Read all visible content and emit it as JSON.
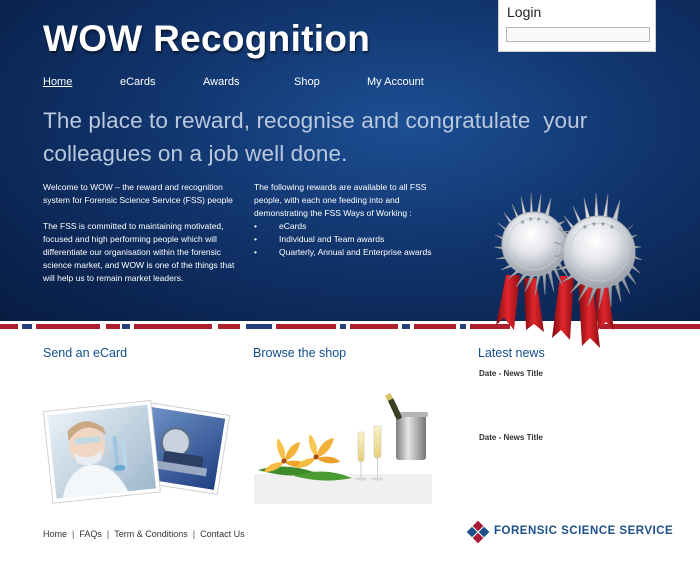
{
  "brand": {
    "title": "WOW Recognition"
  },
  "login": {
    "title": "Login",
    "input_value": ""
  },
  "nav": {
    "items": [
      {
        "label": "Home",
        "active": true
      },
      {
        "label": "eCards"
      },
      {
        "label": "Awards"
      },
      {
        "label": "Shop"
      },
      {
        "label": "My Account"
      }
    ]
  },
  "hero": {
    "tagline_line1": "The place to reward, recognise and congratulate  your",
    "tagline_line2": "colleagues on a job well done.",
    "intro": "Welcome to WOW – the reward and recognition system for Forensic Science Service (FSS) people",
    "commitment": "The FSS is committed to maintaining motivated, focused and high performing people which will differentiate our organisation within the forensic science market, and WOW is one of the things that will help us to remain market leaders.",
    "rewards_intro": "The following rewards are available to all FSS people, with each one feeding into and demonstrating the FSS Ways of Working :",
    "rewards": [
      "eCards",
      "Individual and Team awards",
      "Quarterly, Annual and Enterprise awards"
    ]
  },
  "sections": {
    "ecard_title": "Send an eCard",
    "shop_title": "Browse the shop",
    "news_title": "Latest news",
    "news_items": [
      "Date - News Title",
      "Date - News Title"
    ]
  },
  "footer": {
    "links": [
      "Home",
      "FAQs",
      "Term & Conditions",
      "Contact Us"
    ],
    "sep": "|",
    "logo_text": "FORENSIC SCIENCE SERVICE"
  },
  "colors": {
    "hero_bg": "#11346c",
    "section_title": "#124f8c",
    "stripe_red": "#b11f2e",
    "stripe_blue": "#24407a",
    "logo_red": "#a51c36",
    "logo_blue": "#1d4f8a"
  },
  "icons": {
    "medals": "silver-award-medals-icon",
    "ecard_photo": "laboratory-scientist-photo",
    "shop_photo": "champagne-and-flowers-photo",
    "logo": "fss-diamond-logo"
  }
}
